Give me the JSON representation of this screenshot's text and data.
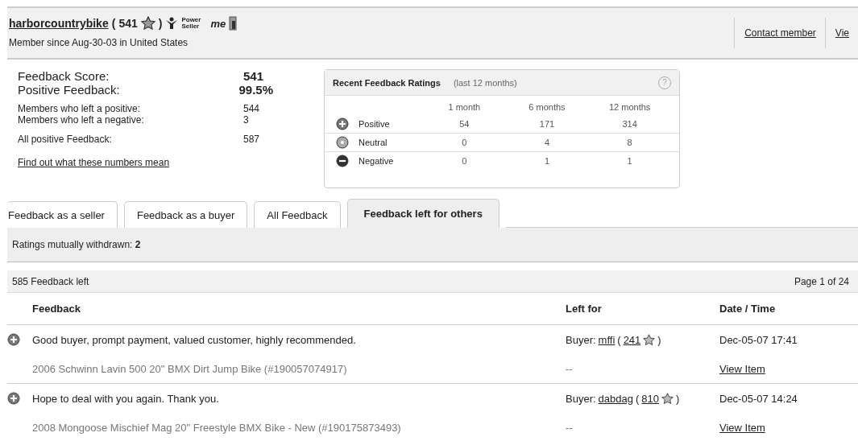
{
  "member": {
    "name": "harborcountrybike",
    "open": "(",
    "score": "541",
    "close": ")",
    "badge": "Power Seller",
    "logo": "me",
    "since": "Member since Aug-30-03 in United States",
    "links": [
      "Contact member",
      "Vie"
    ]
  },
  "stats": [
    {
      "label": "Feedback Score:",
      "value": "541",
      "kind": "big"
    },
    {
      "label": "Positive Feedback:",
      "value": "99.5%",
      "kind": "big"
    },
    {
      "label": "Members who left a positive:",
      "value": "544",
      "kind": "small"
    },
    {
      "label": "Members who left a negative:",
      "value": "3",
      "kind": "small"
    },
    {
      "label": "All positive Feedback:",
      "value": "587",
      "kind": "small"
    }
  ],
  "stats_link": "Find out what these numbers mean",
  "recent": {
    "title": "Recent Feedback Ratings",
    "subtitle": "(last 12 months)",
    "help": "?",
    "columns": [
      "1 month",
      "6 months",
      "12 months"
    ],
    "rows": [
      {
        "kind": "positive",
        "label": "Positive",
        "values": [
          "54",
          "171",
          "314"
        ]
      },
      {
        "kind": "neutral",
        "label": "Neutral",
        "values": [
          "0",
          "4",
          "8"
        ]
      },
      {
        "kind": "negative",
        "label": "Negative",
        "values": [
          "0",
          "1",
          "1"
        ]
      }
    ]
  },
  "tabs": [
    {
      "label": "Feedback as a seller",
      "selected": false
    },
    {
      "label": "Feedback as a buyer",
      "selected": false
    },
    {
      "label": "All Feedback",
      "selected": false
    },
    {
      "label": "Feedback left for others",
      "selected": true
    }
  ],
  "withdrawn": {
    "label": "Ratings mutually withdrawn:",
    "value": "2"
  },
  "list": {
    "count": "585 Feedback left",
    "page": "Page 1 of 24",
    "columns": [
      "Feedback",
      "Left for",
      "Date / Time"
    ],
    "rows": [
      {
        "kind": "positive",
        "comment": "Good buyer, prompt payment, valued customer, highly recommended.",
        "role": "Buyer:",
        "user": "mffi",
        "open": "(",
        "score": "241",
        "close": ")",
        "date": "Dec-05-07 17:41",
        "item": "2006 Schwinn Lavin 500 20\" BMX Dirt Jump Bike (#190057074917)",
        "price": "--",
        "link": "View Item"
      },
      {
        "kind": "positive",
        "comment": "Hope to deal with you again. Thank you.",
        "role": "Buyer:",
        "user": "dabdag",
        "open": "(",
        "score": "810",
        "close": ")",
        "date": "Dec-05-07 14:24",
        "item": "2008 Mongoose Mischief Mag 20\" Freestyle BMX Bike - New (#190175873493)",
        "price": "--",
        "link": "View Item"
      }
    ]
  }
}
